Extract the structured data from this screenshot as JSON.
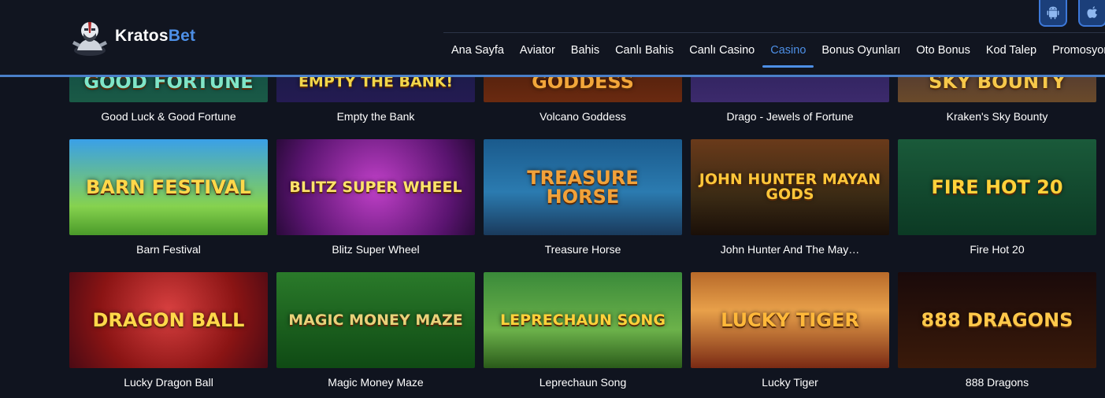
{
  "header": {
    "brand_prefix": "Kratos",
    "brand_suffix": "Bet",
    "app_buttons": [
      {
        "icon": "android-icon",
        "label": "Android"
      },
      {
        "icon": "apple-icon",
        "label": "iOS"
      }
    ],
    "nav": [
      {
        "label": "Ana Sayfa",
        "active": false
      },
      {
        "label": "Aviator",
        "active": false
      },
      {
        "label": "Bahis",
        "active": false
      },
      {
        "label": "Canlı Bahis",
        "active": false
      },
      {
        "label": "Canlı Casino",
        "active": false
      },
      {
        "label": "Casino",
        "active": true
      },
      {
        "label": "Bonus Oyunları",
        "active": false
      },
      {
        "label": "Oto Bonus",
        "active": false
      },
      {
        "label": "Kod Talep",
        "active": false
      },
      {
        "label": "Promosyonlar",
        "active": false
      }
    ],
    "accent_color": "#4d8fe6"
  },
  "games": [
    {
      "name": "Good Luck & Good Fortune",
      "art_text": "GOOD FORTUNE",
      "art_color": "#7fe6c8"
    },
    {
      "name": "Empty the Bank",
      "art_text": "Empty the BANK!",
      "art_color": "#f2d64a"
    },
    {
      "name": "Volcano Goddess",
      "art_text": "GODDESS",
      "art_color": "#f2a63a"
    },
    {
      "name": "Drago - Jewels of Fortune",
      "art_text": "",
      "art_color": "#c8a0ff"
    },
    {
      "name": "Kraken's Sky Bounty",
      "art_text": "SKY BOUNTY",
      "art_color": "#f6c84a"
    },
    {
      "name": "Barn Festival",
      "art_text": "BARN FESTIVAL",
      "art_color": "#ffd84a"
    },
    {
      "name": "Blitz Super Wheel",
      "art_text": "BLITZ SUPER WHEEL",
      "art_color": "#ffe46a"
    },
    {
      "name": "Treasure Horse",
      "art_text": "TREASURE HORSE",
      "art_color": "#f2a23a"
    },
    {
      "name": "John Hunter And The May…",
      "art_text": "JOHN HUNTER MAYAN GODS",
      "art_color": "#ffc63a"
    },
    {
      "name": "Fire Hot 20",
      "art_text": "FIRE HOT 20",
      "art_color": "#ffd23a"
    },
    {
      "name": "Lucky Dragon Ball",
      "art_text": "DRAGON BALL",
      "art_color": "#ffd84a"
    },
    {
      "name": "Magic Money Maze",
      "art_text": "MAGIC MONEY MAZE",
      "art_color": "#e8d27a"
    },
    {
      "name": "Leprechaun Song",
      "art_text": "LEPRECHAUN Song",
      "art_color": "#ffd23a"
    },
    {
      "name": "Lucky Tiger",
      "art_text": "LUCKY TIGER",
      "art_color": "#ffb83a"
    },
    {
      "name": "888 Dragons",
      "art_text": "888 DRAGONS",
      "art_color": "#ffc84a"
    }
  ]
}
